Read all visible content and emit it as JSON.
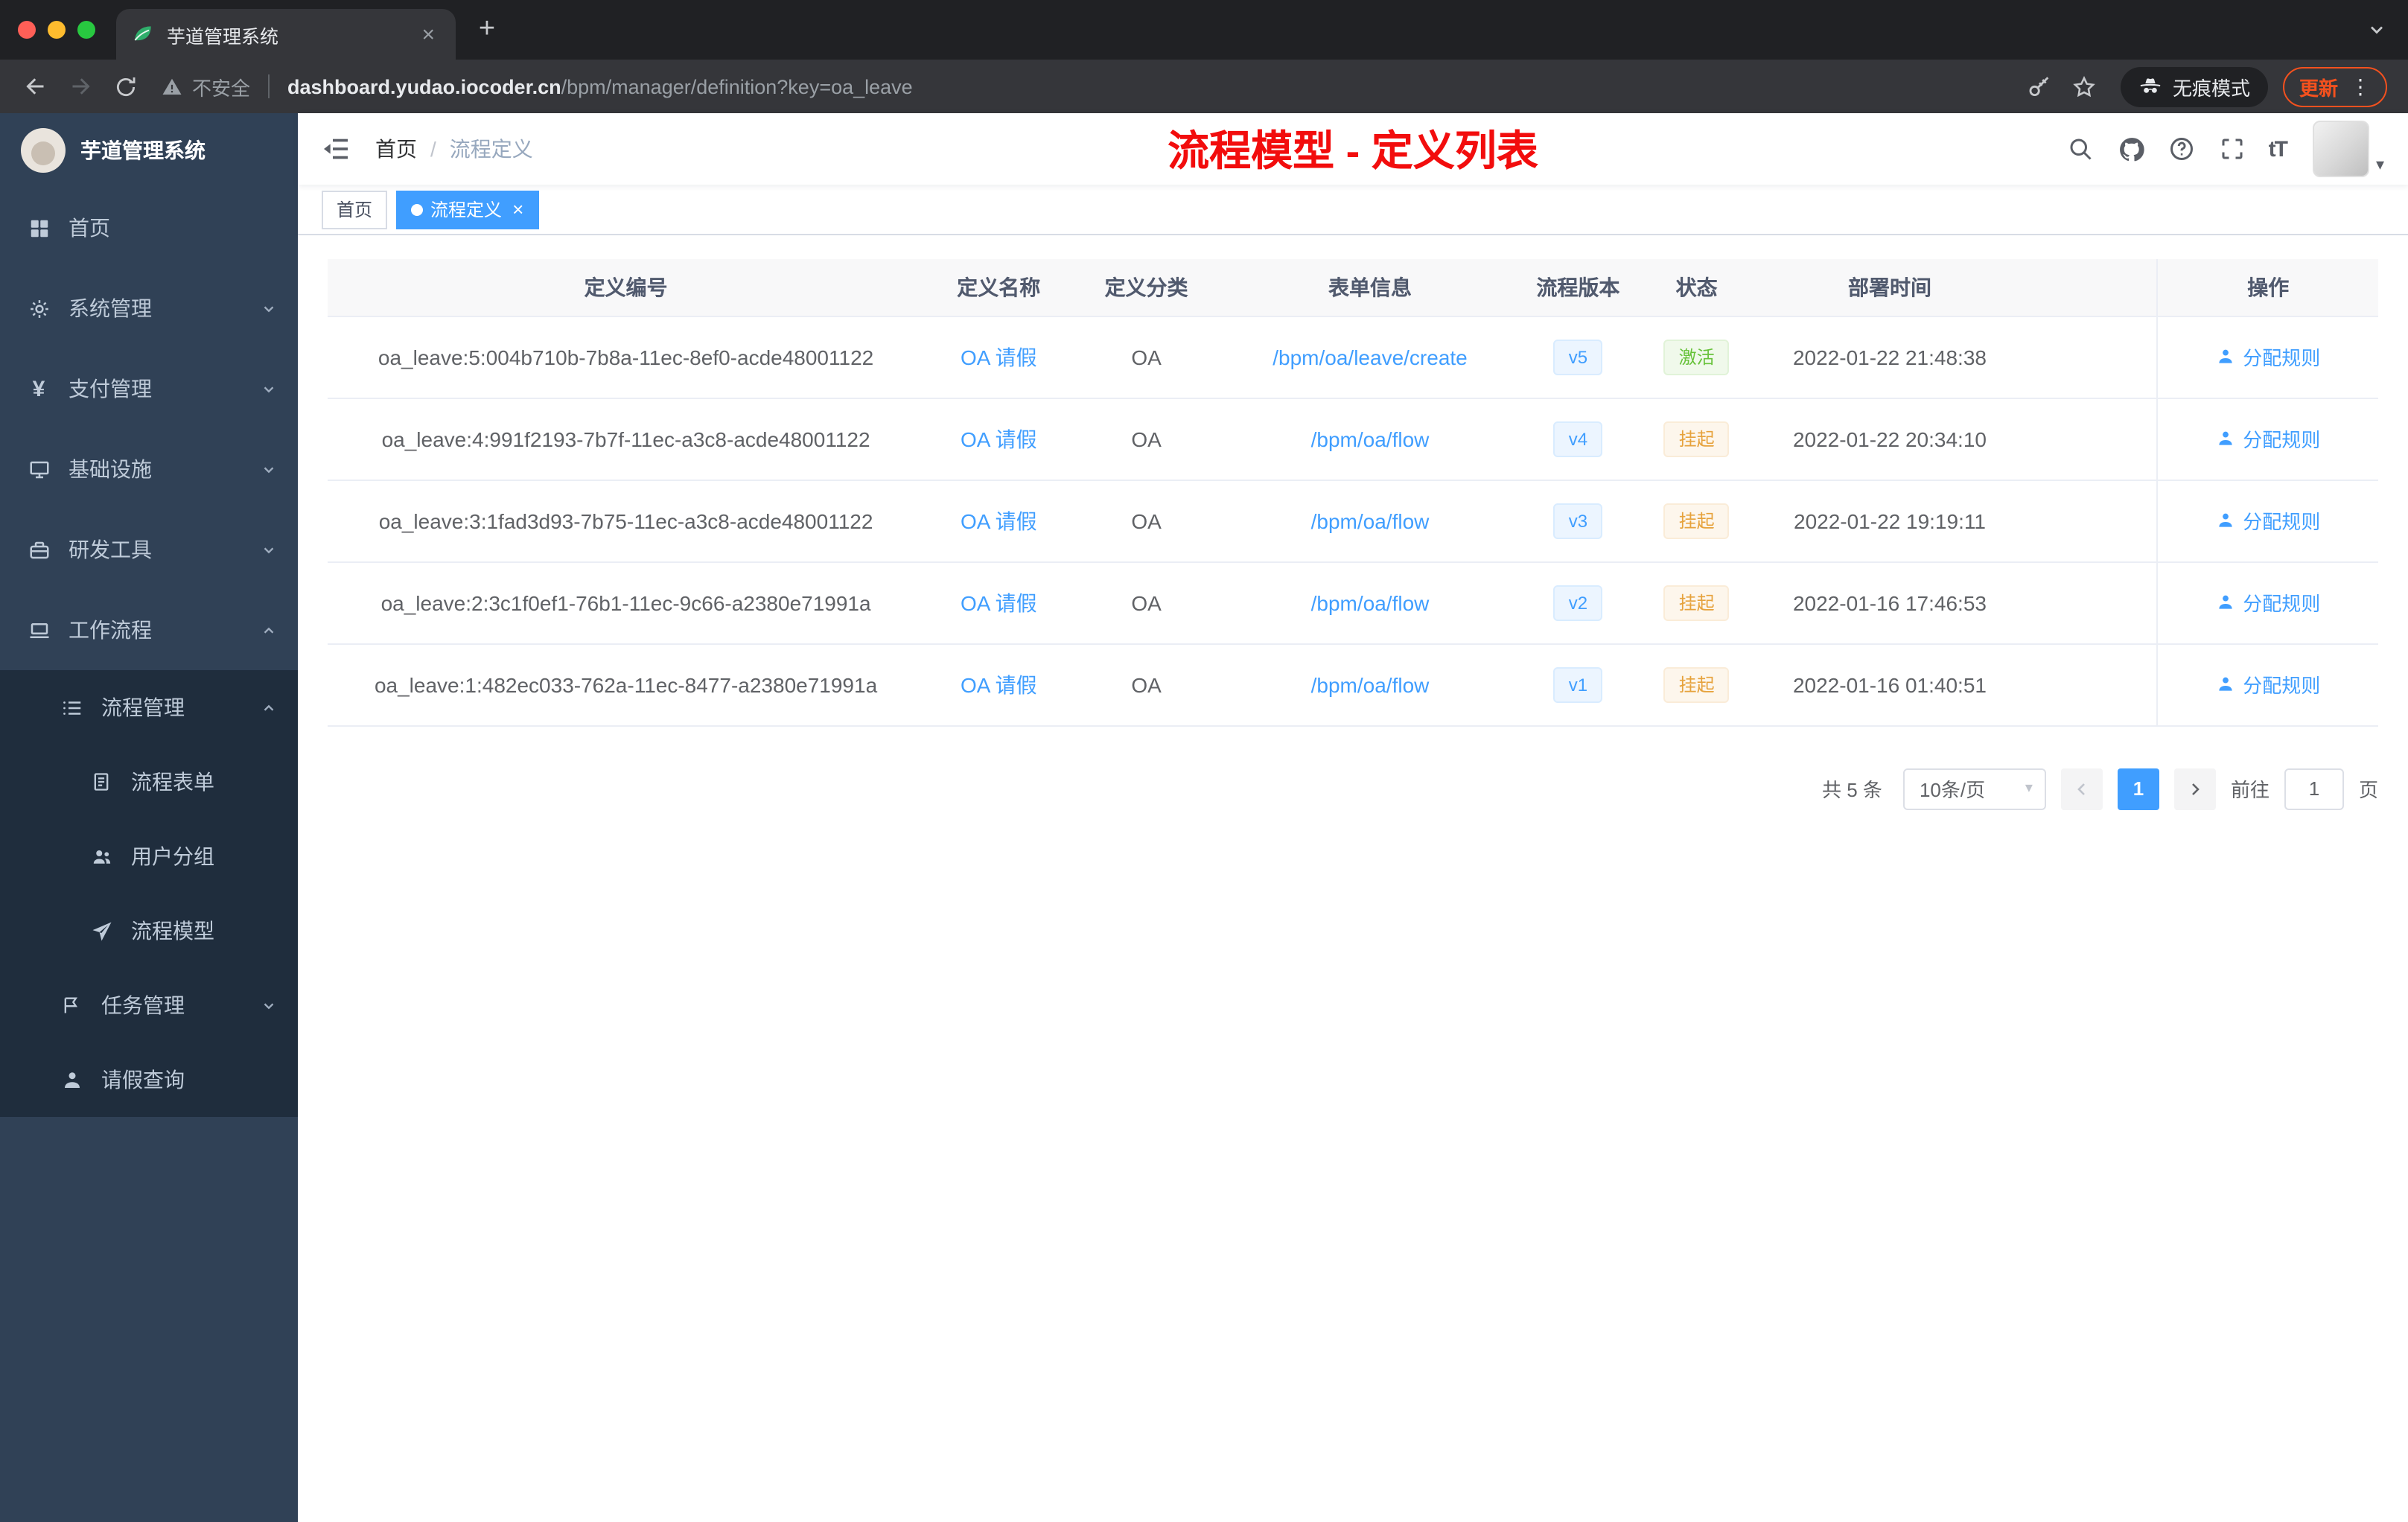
{
  "glyphs": {
    "close": "×",
    "plus": "+",
    "dots": "⋮",
    "caret": "▾",
    "yen": "¥",
    "font_size": "tT"
  },
  "browser": {
    "tab_title": "芋道管理系统",
    "security_label": "不安全",
    "url_domain": "dashboard.yudao.iocoder.cn",
    "url_path": "/bpm/manager/definition?key=oa_leave",
    "incognito_label": "无痕模式",
    "update_label": "更新"
  },
  "sidebar": {
    "logo_title": "芋道管理系统",
    "items": [
      {
        "label": "首页"
      },
      {
        "label": "系统管理"
      },
      {
        "label": "支付管理"
      },
      {
        "label": "基础设施"
      },
      {
        "label": "研发工具"
      },
      {
        "label": "工作流程"
      },
      {
        "label": "流程管理"
      },
      {
        "label": "流程表单"
      },
      {
        "label": "用户分组"
      },
      {
        "label": "流程模型"
      },
      {
        "label": "任务管理"
      },
      {
        "label": "请假查询"
      }
    ]
  },
  "navbar": {
    "breadcrumb": {
      "home": "首页",
      "separator": "/",
      "current": "流程定义"
    },
    "page_title": "流程模型 - 定义列表"
  },
  "tags": {
    "home": "首页",
    "active": "流程定义"
  },
  "table": {
    "columns": [
      "定义编号",
      "定义名称",
      "定义分类",
      "表单信息",
      "流程版本",
      "状态",
      "部署时间",
      "操作"
    ],
    "rows": [
      {
        "id": "oa_leave:5:004b710b-7b8a-11ec-8ef0-acde48001122",
        "name": "OA 请假",
        "category": "OA",
        "form": "/bpm/oa/leave/create",
        "version": "v5",
        "status": "激活",
        "status_type": "success",
        "time": "2022-01-22 21:48:38",
        "action": "分配规则"
      },
      {
        "id": "oa_leave:4:991f2193-7b7f-11ec-a3c8-acde48001122",
        "name": "OA 请假",
        "category": "OA",
        "form": "/bpm/oa/flow",
        "version": "v4",
        "status": "挂起",
        "status_type": "warning",
        "time": "2022-01-22 20:34:10",
        "action": "分配规则"
      },
      {
        "id": "oa_leave:3:1fad3d93-7b75-11ec-a3c8-acde48001122",
        "name": "OA 请假",
        "category": "OA",
        "form": "/bpm/oa/flow",
        "version": "v3",
        "status": "挂起",
        "status_type": "warning",
        "time": "2022-01-22 19:19:11",
        "action": "分配规则"
      },
      {
        "id": "oa_leave:2:3c1f0ef1-76b1-11ec-9c66-a2380e71991a",
        "name": "OA 请假",
        "category": "OA",
        "form": "/bpm/oa/flow",
        "version": "v2",
        "status": "挂起",
        "status_type": "warning",
        "time": "2022-01-16 17:46:53",
        "action": "分配规则"
      },
      {
        "id": "oa_leave:1:482ec033-762a-11ec-8477-a2380e71991a",
        "name": "OA 请假",
        "category": "OA",
        "form": "/bpm/oa/flow",
        "version": "v1",
        "status": "挂起",
        "status_type": "warning",
        "time": "2022-01-16 01:40:51",
        "action": "分配规则"
      }
    ]
  },
  "pagination": {
    "total": "共 5 条",
    "page_size": "10条/页",
    "page": "1",
    "goto_label": "前往",
    "goto_value": "1",
    "unit": "页"
  },
  "colors": {
    "accent": "#409eff",
    "success": "#67c23a",
    "warning": "#e6a23c",
    "title_red": "#f20d0d"
  }
}
